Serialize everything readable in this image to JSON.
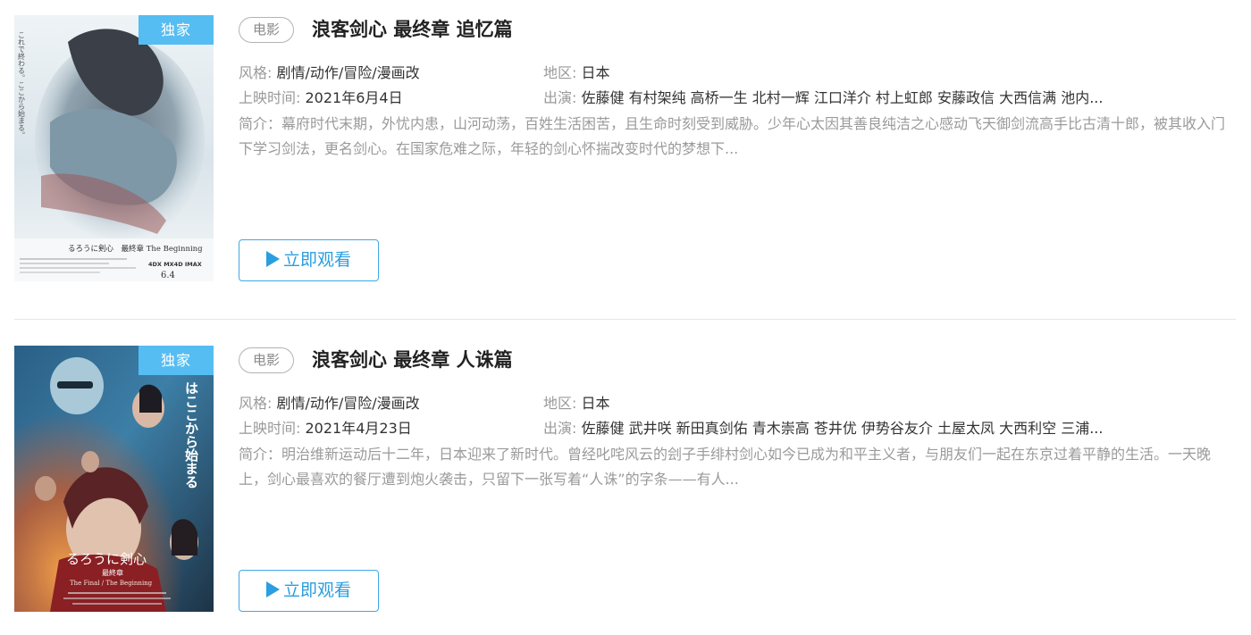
{
  "movies": [
    {
      "badge": "独家",
      "type_tag": "电影",
      "title": "浪客剑心 最终章 追忆篇",
      "genre_label": "风格:",
      "genre": "剧情/动作/冒险/漫画改",
      "region_label": "地区:",
      "region": "日本",
      "release_label": "上映时间:",
      "release": "2021年6月4日",
      "cast_label": "出演:",
      "cast": "佐藤健 有村架纯 高桥一生 北村一辉 江口洋介 村上虹郎 安藤政信 大西信满 池内...",
      "intro": "简介：幕府时代末期，外忧内患，山河动荡，百姓生活困苦，且生命时刻受到威胁。少年心太因其善良纯洁之心感动飞天御剑流高手比古清十郎，被其收入门下学习剑法，更名剑心。在国家危难之际，年轻的剑心怀揣改变时代的梦想下...",
      "watch_label": "立即观看",
      "poster_text": "るろうに剣心　最終章 The Beginning",
      "poster_tagline": "これで終わる。ここから始まる。",
      "poster_date": "6.4",
      "poster_formats": "4DX MX4D IMAX"
    },
    {
      "badge": "独家",
      "type_tag": "电影",
      "title": "浪客剑心 最终章 人诛篇",
      "genre_label": "风格:",
      "genre": "剧情/动作/冒险/漫画改",
      "region_label": "地区:",
      "region": "日本",
      "release_label": "上映时间:",
      "release": "2021年4月23日",
      "cast_label": "出演:",
      "cast": "佐藤健 武井咲 新田真剑佑 青木崇高 苍井优 伊势谷友介 土屋太凤 大西利空 三浦...",
      "intro": "简介：明治维新运动后十二年，日本迎来了新时代。曾经叱咤风云的刽子手绯村剑心如今已成为和平主义者，与朋友们一起在东京过着平静的生活。一天晚上，剑心最喜欢的餐厅遭到炮火袭击，只留下一张写着“人诛”的字条——有人...",
      "watch_label": "立即观看",
      "poster_text": "るろうに剣心",
      "poster_subtext": "最終章",
      "poster_subtitle": "The Final / The Beginning",
      "poster_tagline": "はここから始まる"
    }
  ],
  "colors": {
    "badge": "#55bdf2",
    "accent": "#2a9ee0",
    "muted": "#999999",
    "divider": "#e6e6e6"
  },
  "icons": {
    "watch": "play-icon"
  }
}
